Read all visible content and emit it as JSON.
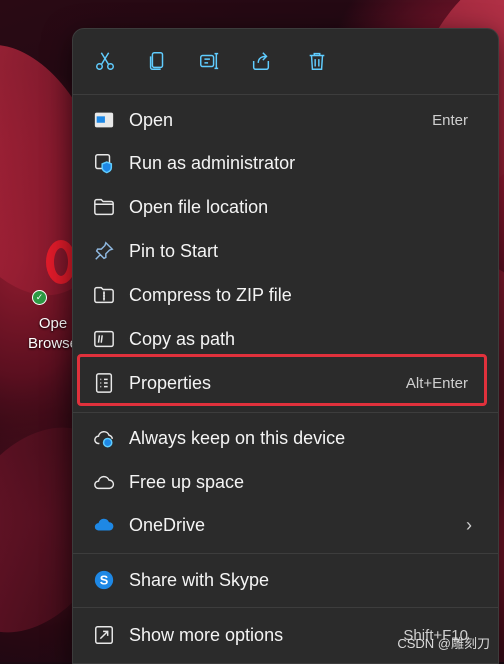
{
  "desktop": {
    "icon_label": "Ope\nBrowse"
  },
  "quick_actions": [
    {
      "name": "cut-icon"
    },
    {
      "name": "copy-icon"
    },
    {
      "name": "rename-icon"
    },
    {
      "name": "share-icon"
    },
    {
      "name": "delete-icon"
    }
  ],
  "menu": {
    "items": [
      {
        "label": "Open",
        "shortcut": "Enter",
        "icon": "open-icon"
      },
      {
        "label": "Run as administrator",
        "shortcut": "",
        "icon": "admin-shield-icon"
      },
      {
        "label": "Open file location",
        "shortcut": "",
        "icon": "folder-icon"
      },
      {
        "label": "Pin to Start",
        "shortcut": "",
        "icon": "pin-icon"
      },
      {
        "label": "Compress to ZIP file",
        "shortcut": "",
        "icon": "zip-folder-icon"
      },
      {
        "label": "Copy as path",
        "shortcut": "",
        "icon": "copy-path-icon"
      },
      {
        "label": "Properties",
        "shortcut": "Alt+Enter",
        "icon": "properties-icon"
      },
      {
        "label": "Always keep on this device",
        "shortcut": "",
        "icon": "cloud-sync-icon"
      },
      {
        "label": "Free up space",
        "shortcut": "",
        "icon": "cloud-icon"
      },
      {
        "label": "OneDrive",
        "shortcut": "",
        "icon": "onedrive-icon"
      },
      {
        "label": "Share with Skype",
        "shortcut": "",
        "icon": "skype-icon"
      },
      {
        "label": "Show more options",
        "shortcut": "Shift+F10",
        "icon": "more-options-icon"
      }
    ]
  },
  "watermark": "CSDN @雕刻刀",
  "colors": {
    "menu_bg": "#2b2b2b",
    "accent": "#60cdff",
    "highlight_border": "#e0313c"
  }
}
